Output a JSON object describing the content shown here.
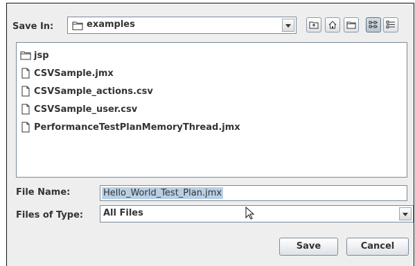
{
  "save_in": {
    "label": "Save In:",
    "value": "examples"
  },
  "toolbar": {
    "up_one_level": "up-folder-icon",
    "home": "home-icon",
    "new_folder": "new-folder-icon",
    "list_view": "list-view-icon",
    "details_view": "details-view-icon"
  },
  "files": [
    {
      "name": "jsp",
      "type": "folder"
    },
    {
      "name": "CSVSample.jmx",
      "type": "file"
    },
    {
      "name": "CSVSample_actions.csv",
      "type": "file"
    },
    {
      "name": "CSVSample_user.csv",
      "type": "file"
    },
    {
      "name": "PerformanceTestPlanMemoryThread.jmx",
      "type": "file"
    }
  ],
  "file_name": {
    "label": "File Name:",
    "value": "Hello_World_Test_Plan.jmx"
  },
  "files_of_type": {
    "label": "Files of Type:",
    "value": "All Files"
  },
  "buttons": {
    "save": "Save",
    "cancel": "Cancel"
  },
  "colors": {
    "selection": "#b8cfe5",
    "panel": "#eeeeee",
    "border": "#7a8a99"
  }
}
